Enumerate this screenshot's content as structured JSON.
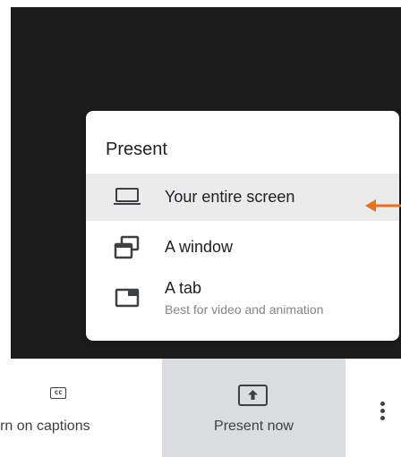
{
  "menu": {
    "title": "Present",
    "items": [
      {
        "label": "Your entire screen",
        "icon": "laptop-icon",
        "selected": true
      },
      {
        "label": "A window",
        "icon": "window-icon"
      },
      {
        "label": "A tab",
        "sublabel": "Best for video and animation",
        "icon": "tab-icon"
      }
    ]
  },
  "bottom_bar": {
    "captions_label": "Turn on captions",
    "captions_icon": "cc",
    "present_label": "Present now",
    "present_icon": "present-to-all-icon",
    "more_icon": "more-vert-icon"
  },
  "annotation": {
    "icon": "orange-arrow-icon",
    "color": "#e8711a"
  },
  "colors": {
    "video_bg": "#1c1c1c",
    "selected_bg": "#ebebeb",
    "present_btn_bg": "#dadce0",
    "text": "#202124"
  }
}
